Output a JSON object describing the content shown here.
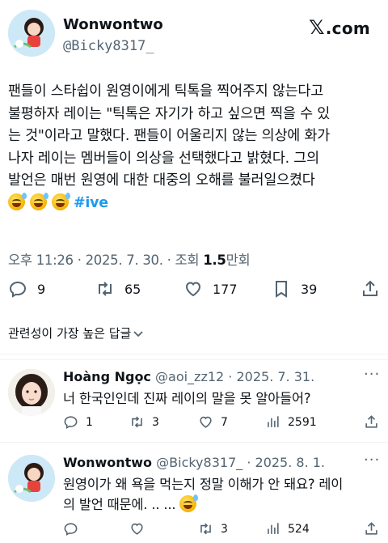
{
  "header": {
    "display_name": "Wonwontwo",
    "handle": "@Bicky8317_",
    "logo_text": ".com",
    "logo_icon": "x-logo-icon"
  },
  "tweet": {
    "lines": [
      "팬들이 스타쉽이 원영이에게 틱톡을 찍어주지 않는다고",
      "불평하자 레이는 \"틱톡은 자기가 하고 싶으면 찍을 수 있",
      "는 것\"이라고 말했다. 팬들이 어울리지 않는 의상에 화가",
      "나자 레이는 멤버들이 의상을 선택했다고 밝혔다. 그의",
      "발언은 매번 원영에 대한 대중의 오해를 불러일으켰다"
    ],
    "emoji": "sweat-smile-emoji",
    "hashtag": "#ive",
    "time": "오후 11:26 · 2025. 7. 30. · 조회 ",
    "views": "1.5",
    "views_unit": "만회"
  },
  "actions": {
    "replies": "9",
    "retweets": "65",
    "likes": "177",
    "bookmarks": "39"
  },
  "sort_label": "관련성이 가장 높은 답글",
  "replies": [
    {
      "name": "Hoàng Ngọc",
      "handle": "@aoi_zz12",
      "date": " · 2025. 7. 31.",
      "text": "너 한국인인데 진짜 레이의 말을 못 알아들어?",
      "reply_count": "1",
      "retweet_count": "3",
      "like_count": "7",
      "view_count": "2591"
    },
    {
      "name": "Wonwontwo",
      "handle": "@Bicky8317_",
      "date": " · 2025. 8. 1.",
      "text_line1": "원영이가 왜 욕을 먹는지 정말 이해가 안 돼요? 레이",
      "text_line2": "의 발언 때문에. .. ...",
      "reply_count": "",
      "retweet_count": "3",
      "like_count": "",
      "view_count": "524"
    }
  ],
  "colors": {
    "text": "#0f1419",
    "secondary": "#536471",
    "accent": "#1d9bf0",
    "divider": "#eff3f4"
  }
}
